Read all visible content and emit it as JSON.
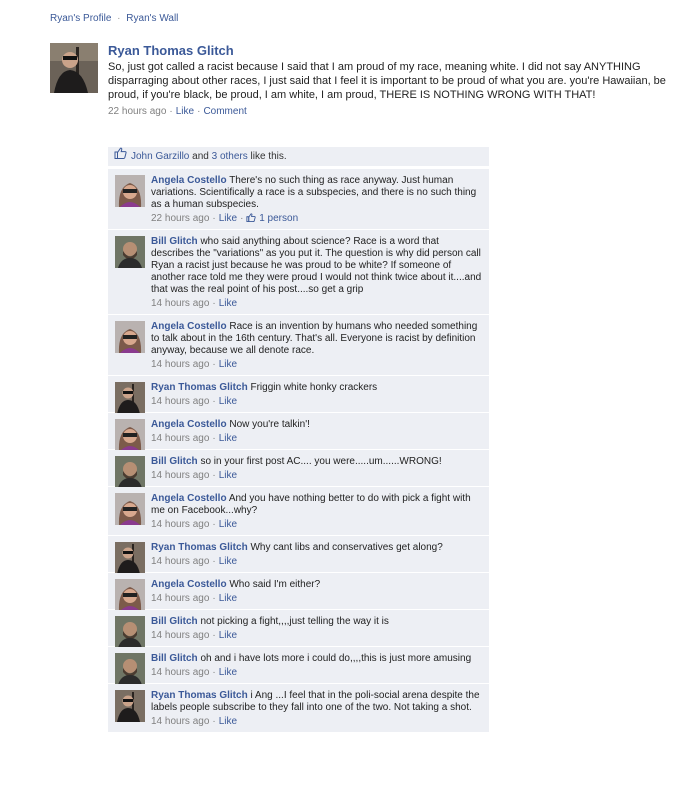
{
  "breadcrumb": {
    "profile": "Ryan's Profile",
    "sep": "·",
    "wall": "Ryan's Wall"
  },
  "post": {
    "author": "Ryan Thomas Glitch",
    "text": "So, just got called a racist because I said that I am proud of my race, meaning white. I did not say ANYTHING disparraging about other races, I just said that I feel it is important to be proud of what you are. you're Hawaiian, be proud, if you're black, be proud, I am white, I am proud, THERE IS NOTHING WRONG WITH THAT!",
    "time": "22 hours ago",
    "sep": "·",
    "like": "Like",
    "comment": "Comment"
  },
  "likes": {
    "name": "John Garzillo",
    "and": " and ",
    "others": "3 others",
    "tail": " like this."
  },
  "comments": [
    {
      "author": "Angela Costello",
      "avatar": "angela",
      "text": "There's no such thing as race anyway. Just human variations. Scientifically a race is a subspecies, and there is no such thing as a human subspecies.",
      "time": "22 hours ago",
      "like": "Like",
      "likes_count": "1 person"
    },
    {
      "author": "Bill Glitch",
      "avatar": "bill",
      "text": "who said anything about science? Race is a word that describes the \"variations\" as you put it. The question is why did person call Ryan a racist just because he was proud to be white? If someone of another race told me they were proud I would not think twice about it....and that was the real point of his post....so get a grip",
      "time": "14 hours ago",
      "like": "Like"
    },
    {
      "author": "Angela Costello",
      "avatar": "angela",
      "text": "Race is an invention by humans who needed something to talk about in the 16th century. That's all. Everyone is racist by definition anyway, because we all denote race.",
      "time": "14 hours ago",
      "like": "Like"
    },
    {
      "author": "Ryan Thomas Glitch",
      "avatar": "ryan",
      "text": "Friggin white honky crackers",
      "time": "14 hours ago",
      "like": "Like"
    },
    {
      "author": "Angela Costello",
      "avatar": "angela",
      "text": "Now you're talkin'!",
      "time": "14 hours ago",
      "like": "Like"
    },
    {
      "author": "Bill Glitch",
      "avatar": "bill",
      "text": "so in your first post AC.... you were.....um......WRONG!",
      "time": "14 hours ago",
      "like": "Like"
    },
    {
      "author": "Angela Costello",
      "avatar": "angela",
      "text": "And you have nothing better to do with pick a fight with me on Facebook...why?",
      "time": "14 hours ago",
      "like": "Like"
    },
    {
      "author": "Ryan Thomas Glitch",
      "avatar": "ryan",
      "text": "Why cant libs and conservatives get along?",
      "time": "14 hours ago",
      "like": "Like"
    },
    {
      "author": "Angela Costello",
      "avatar": "angela",
      "text": "Who said I'm either?",
      "time": "14 hours ago",
      "like": "Like"
    },
    {
      "author": "Bill Glitch",
      "avatar": "bill",
      "text": "not picking a fight,,,,just telling the way it is",
      "time": "14 hours ago",
      "like": "Like"
    },
    {
      "author": "Bill Glitch",
      "avatar": "bill",
      "text": "oh and i have lots more i could do,,,,this is just more amusing",
      "time": "14 hours ago",
      "like": "Like"
    },
    {
      "author": "Ryan Thomas Glitch",
      "avatar": "ryan",
      "text": "i Ang ...I feel that in the poli-social arena despite the labels people subscribe to they fall into one of the two. Not taking a shot.",
      "time": "14 hours ago",
      "like": "Like"
    }
  ],
  "colors": {
    "link": "#3b5998",
    "comment_bg": "#edeff4",
    "meta": "#808080"
  }
}
